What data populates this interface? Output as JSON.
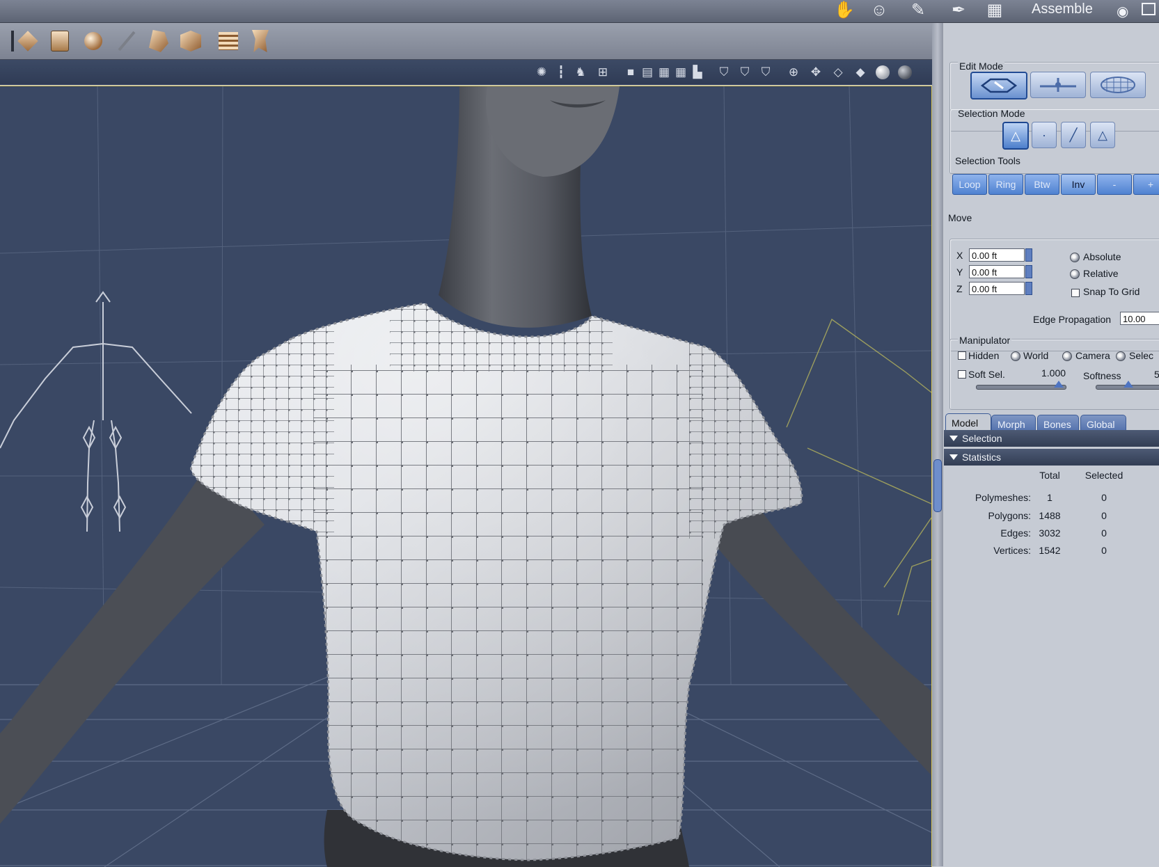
{
  "room_bar": {
    "room_name": "Assemble",
    "icons": [
      "hand-icon",
      "face-icon",
      "brush-icon",
      "pen-icon",
      "film-icon",
      "eye-icon",
      "window-icon"
    ]
  },
  "toolbar": {
    "icons": [
      "box-icon",
      "bag-icon",
      "sphere-icon",
      "wand-icon",
      "figure-icon",
      "puzzle-icon",
      "panel-icon",
      "torso-icon"
    ]
  },
  "viewport_header": {
    "icons": [
      "light-icon",
      "camera-icon",
      "figure-icon",
      "grid-icon",
      "layout-1-icon",
      "layout-2-icon",
      "layout-3-icon",
      "layout-4-icon",
      "layout-5-icon",
      "shield-1-icon",
      "shield-2-icon",
      "shield-3-icon",
      "navigate-icon",
      "move-icon",
      "cube-wire-icon",
      "cube-solid-icon",
      "sphere-lit-icon",
      "sphere-dark-icon"
    ]
  },
  "panel": {
    "edit_mode": {
      "title": "Edit Mode"
    },
    "selection_mode": {
      "title": "Selection Mode"
    },
    "selection_tools": {
      "title": "Selection Tools",
      "buttons": [
        "Loop",
        "Ring",
        "Btw",
        "Inv",
        "-",
        "+"
      ]
    },
    "move": {
      "title": "Move",
      "x_label": "X",
      "x_value": "0.00 ft",
      "y_label": "Y",
      "y_value": "0.00 ft",
      "z_label": "Z",
      "z_value": "0.00 ft",
      "absolute": "Absolute",
      "relative": "Relative",
      "snap_to_grid": "Snap To Grid",
      "edge_propagation_label": "Edge Propagation",
      "edge_propagation_value": "10.00"
    },
    "manipulator": {
      "title": "Manipulator",
      "hidden": "Hidden",
      "world": "World",
      "camera": "Camera",
      "selection": "Selec",
      "soft_sel": "Soft Sel.",
      "soft_sel_value": "1.000",
      "softness": "Softness",
      "softness_value": "5"
    },
    "tabs": [
      "Model",
      "Morph",
      "Bones",
      "Global"
    ],
    "sections": {
      "selection": "Selection",
      "statistics": "Statistics"
    },
    "statistics": {
      "col_total": "Total",
      "col_selected": "Selected",
      "rows": [
        {
          "label": "Polymeshes:",
          "total": "1",
          "selected": "0"
        },
        {
          "label": "Polygons:",
          "total": "1488",
          "selected": "0"
        },
        {
          "label": "Edges:",
          "total": "3032",
          "selected": "0"
        },
        {
          "label": "Vertices:",
          "total": "1542",
          "selected": "0"
        }
      ]
    }
  }
}
